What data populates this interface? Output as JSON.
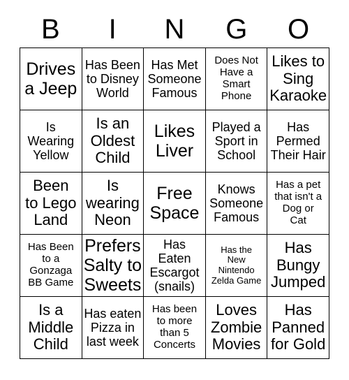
{
  "card": {
    "header_letters": [
      "B",
      "I",
      "N",
      "G",
      "O"
    ],
    "columns": 5,
    "rows": 5,
    "free_space_position": {
      "row": 3,
      "column": 3
    },
    "colors": {
      "background": "#ffffff",
      "text": "#000000",
      "grid_line": "#000000"
    },
    "cells": [
      {
        "row": 1,
        "column": 1,
        "text": "Drives\na Jeep",
        "size": "xl"
      },
      {
        "row": 1,
        "column": 2,
        "text": "Has Been\nto Disney\nWorld",
        "size": "md"
      },
      {
        "row": 1,
        "column": 3,
        "text": "Has Met\nSomeone\nFamous",
        "size": "md"
      },
      {
        "row": 1,
        "column": 4,
        "text": "Does Not\nHave a\nSmart\nPhone",
        "size": "sm"
      },
      {
        "row": 1,
        "column": 5,
        "text": "Likes to\nSing\nKaraoke",
        "size": "lg"
      },
      {
        "row": 2,
        "column": 1,
        "text": "Is\nWearing\nYellow",
        "size": "md"
      },
      {
        "row": 2,
        "column": 2,
        "text": "Is an\nOldest\nChild",
        "size": "lg"
      },
      {
        "row": 2,
        "column": 3,
        "text": "Likes\nLiver",
        "size": "xl"
      },
      {
        "row": 2,
        "column": 4,
        "text": "Played a\nSport in\nSchool",
        "size": "md"
      },
      {
        "row": 2,
        "column": 5,
        "text": "Has\nPermed\nTheir Hair",
        "size": "md"
      },
      {
        "row": 3,
        "column": 1,
        "text": "Been\nto Lego\nLand",
        "size": "lg"
      },
      {
        "row": 3,
        "column": 2,
        "text": "Is\nwearing\nNeon",
        "size": "lg"
      },
      {
        "row": 3,
        "column": 3,
        "text": "Free\nSpace",
        "size": "xl"
      },
      {
        "row": 3,
        "column": 4,
        "text": "Knows\nSomeone\nFamous",
        "size": "md"
      },
      {
        "row": 3,
        "column": 5,
        "text": "Has a pet\nthat isn't a\nDog or\nCat",
        "size": "sm"
      },
      {
        "row": 4,
        "column": 1,
        "text": "Has Been\nto a\nGonzaga\nBB Game",
        "size": "sm"
      },
      {
        "row": 4,
        "column": 2,
        "text": "Prefers\nSalty to\nSweets",
        "size": "xl"
      },
      {
        "row": 4,
        "column": 3,
        "text": "Has Eaten\nEscargot\n(snails)",
        "size": "md"
      },
      {
        "row": 4,
        "column": 4,
        "text": "Has the\nNew\nNintendo\nZelda Game",
        "size": "xs"
      },
      {
        "row": 4,
        "column": 5,
        "text": "Has\nBungy\nJumped",
        "size": "lg"
      },
      {
        "row": 5,
        "column": 1,
        "text": "Is a\nMiddle\nChild",
        "size": "lg"
      },
      {
        "row": 5,
        "column": 2,
        "text": "Has eaten\nPizza in\nlast week",
        "size": "md"
      },
      {
        "row": 5,
        "column": 3,
        "text": "Has been\nto more\nthan 5\nConcerts",
        "size": "sm"
      },
      {
        "row": 5,
        "column": 4,
        "text": "Loves\nZombie\nMovies",
        "size": "lg"
      },
      {
        "row": 5,
        "column": 5,
        "text": "Has\nPanned\nfor Gold",
        "size": "lg"
      }
    ]
  }
}
